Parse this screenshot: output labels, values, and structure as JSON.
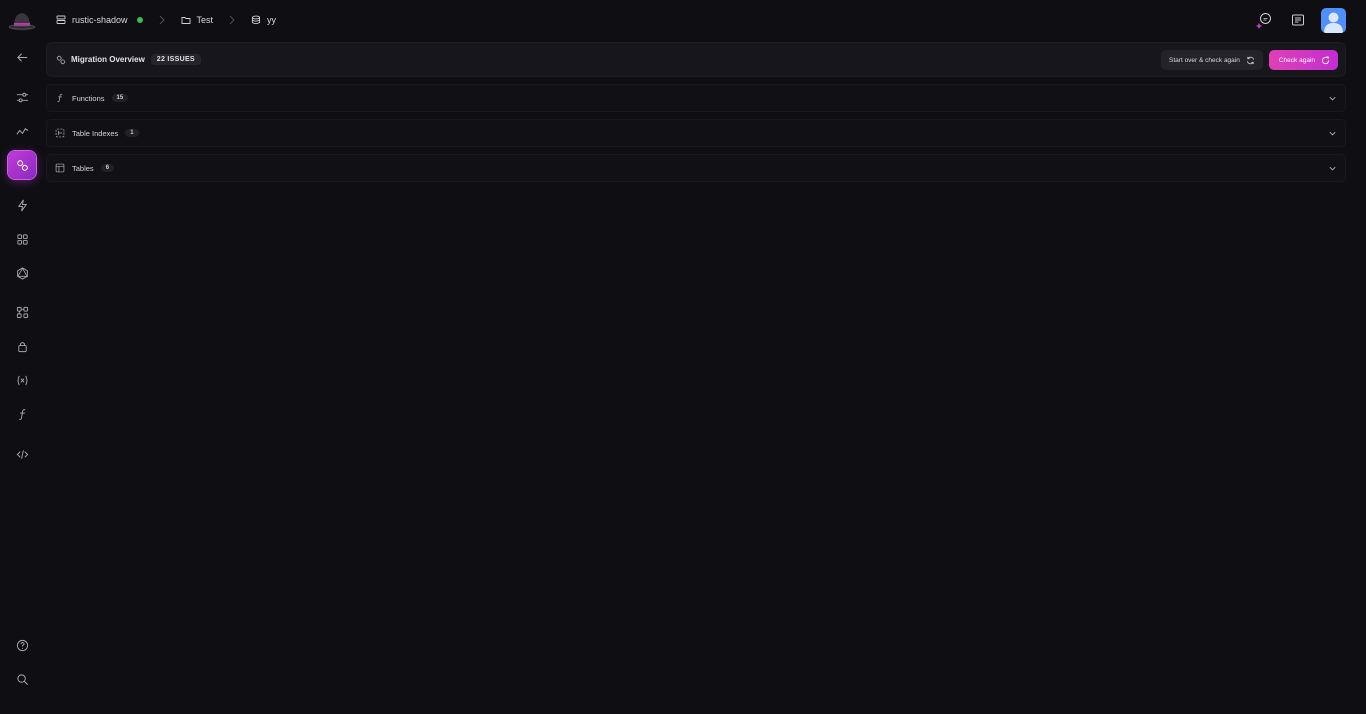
{
  "topbar": {
    "project": "rustic-shadow",
    "folder": "Test",
    "database": "yy",
    "status_color": "#3fb950"
  },
  "sidebar": {
    "items": [
      {
        "icon": "back-arrow-icon"
      },
      {
        "icon": "sliders-icon"
      },
      {
        "icon": "activity-icon"
      },
      {
        "icon": "migration-icon",
        "active": true
      },
      {
        "icon": "lightning-icon"
      },
      {
        "icon": "grid-icon"
      },
      {
        "icon": "graphql-icon"
      },
      {
        "icon": "nodes-icon"
      },
      {
        "icon": "lock-icon"
      },
      {
        "icon": "variable-icon"
      },
      {
        "icon": "function-icon"
      },
      {
        "icon": "code-icon"
      },
      {
        "icon": "help-icon"
      },
      {
        "icon": "search-icon"
      }
    ]
  },
  "overview": {
    "title": "Migration Overview",
    "issues": "22 ISSUES",
    "start_over_label": "Start over & check again",
    "check_again_label": "Check again"
  },
  "sections": [
    {
      "label": "Functions",
      "count": "15",
      "icon": "function-icon"
    },
    {
      "label": "Table Indexes",
      "count": "1",
      "icon": "index-icon"
    },
    {
      "label": "Tables",
      "count": "6",
      "icon": "table-icon"
    }
  ],
  "colors": {
    "accent": "#d63bc6",
    "background": "#0f0e13"
  }
}
